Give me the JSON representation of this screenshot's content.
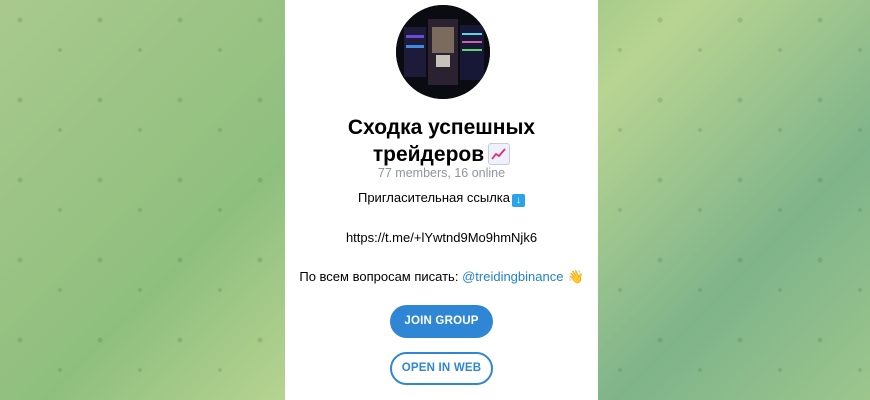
{
  "group": {
    "title_line1": "Сходка успешных",
    "title_line2": "трейдеров",
    "title_emoji": "chart-increasing-icon",
    "members_text": "77 members, 16 online"
  },
  "description": {
    "line1": "Пригласительная ссылка",
    "line1_emoji": "down-arrow-icon",
    "link": "https://t.me/+lYwtnd9Mo9hmNjk6",
    "line3_prefix": "По всем вопросам писать:",
    "mention": "@treidingbinance",
    "line3_emoji": "waving-hand-icon"
  },
  "buttons": {
    "join_label": "JOIN GROUP",
    "web_label": "OPEN IN WEB"
  },
  "colors": {
    "accent": "#2f86d4",
    "mention": "#2481cc",
    "muted": "#8f959b"
  }
}
